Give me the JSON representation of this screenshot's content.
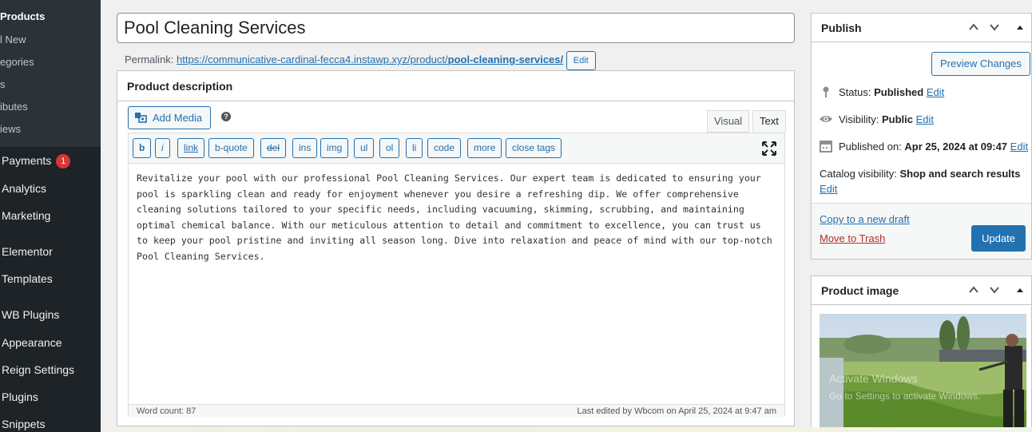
{
  "sidebar": {
    "submenu": [
      {
        "label": "Products",
        "current": true
      },
      {
        "label": "l New"
      },
      {
        "label": "egories"
      },
      {
        "label": "s"
      },
      {
        "label": "ibutes"
      },
      {
        "label": "iews"
      }
    ],
    "menu": [
      {
        "label": "Payments",
        "badge": "1"
      },
      {
        "label": "Analytics"
      },
      {
        "label": "Marketing"
      },
      {
        "label": "Elementor"
      },
      {
        "label": "Templates"
      },
      {
        "label": "WB Plugins"
      },
      {
        "label": "Appearance"
      },
      {
        "label": "Reign Settings"
      },
      {
        "label": "Plugins"
      },
      {
        "label": "Snippets"
      }
    ]
  },
  "post": {
    "title": "Pool Cleaning Services",
    "permalink_label": "Permalink:",
    "permalink_base": "https://communicative-cardinal-fecca4.instawp.xyz/product/",
    "permalink_slug": "pool-cleaning-services/",
    "permalink_edit": "Edit"
  },
  "description": {
    "heading": "Product description",
    "add_media": "Add Media",
    "tabs": {
      "visual": "Visual",
      "text": "Text"
    },
    "quicktags": [
      "b",
      "i",
      "link",
      "b-quote",
      "del",
      "ins",
      "img",
      "ul",
      "ol",
      "li",
      "code",
      "more",
      "close tags"
    ],
    "content": "Revitalize your pool with our professional Pool Cleaning Services. Our expert team is dedicated to ensuring your pool is sparkling clean and ready for enjoyment whenever you desire a refreshing dip. We offer comprehensive cleaning solutions tailored to your specific needs, including vacuuming, skimming, scrubbing, and maintaining optimal chemical balance. With our meticulous attention to detail and commitment to excellence, you can trust us to keep your pool pristine and inviting all season long. Dive into relaxation and peace of mind with our top-notch Pool Cleaning Services.",
    "word_count": "Word count: 87",
    "last_edited": "Last edited by Wbcom on April 25, 2024 at 9:47 am"
  },
  "publish": {
    "heading": "Publish",
    "preview": "Preview Changes",
    "status_label": "Status:",
    "status_value": "Published",
    "visibility_label": "Visibility:",
    "visibility_value": "Public",
    "published_label": "Published on:",
    "published_value": "Apr 25, 2024 at 09:47",
    "catalog_label": "Catalog visibility:",
    "catalog_value": "Shop and search results",
    "edit": "Edit",
    "copy_draft": "Copy to a new draft",
    "trash": "Move to Trash",
    "update": "Update"
  },
  "product_image": {
    "heading": "Product image",
    "watermark_line1": "Activate Windows",
    "watermark_line2": "Go to Settings to activate Windows."
  },
  "colors": {
    "accent": "#2271b1",
    "sidebar": "#1d2327",
    "danger": "#b32d2e"
  }
}
